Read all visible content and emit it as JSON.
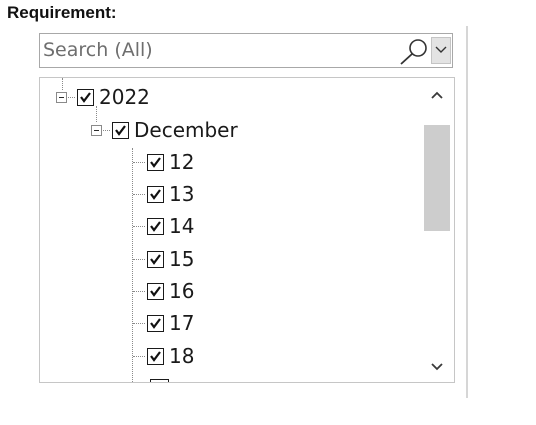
{
  "heading": "Requirement:",
  "search": {
    "placeholder": "Search (All)"
  },
  "tree": {
    "year": {
      "label": "2022",
      "checked": true,
      "expanded": true
    },
    "month": {
      "label": "December",
      "checked": true,
      "expanded": true
    },
    "days": [
      "12",
      "13",
      "14",
      "15",
      "16",
      "17",
      "18"
    ]
  },
  "icons": {
    "search": "magnifier-icon",
    "dropdown": "chevron-down-icon",
    "scroll_up": "chevron-up-icon",
    "scroll_down": "chevron-down-icon"
  }
}
